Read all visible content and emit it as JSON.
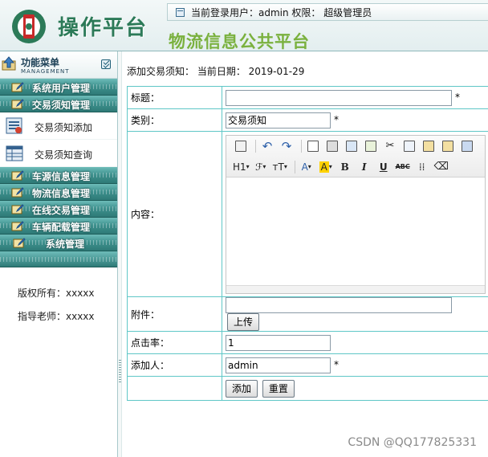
{
  "header": {
    "logo_text": "操作平台",
    "login_info": "当前登录用户：admin 权限： 超级管理员",
    "platform_title": "物流信息公共平台"
  },
  "sidebar": {
    "menu_title": "功能菜单",
    "menu_subtitle": "MANAGEMENT",
    "groups": [
      {
        "label": "系统用户管理"
      },
      {
        "label": "交易须知管理",
        "items": [
          {
            "label": "交易须知添加"
          },
          {
            "label": "交易须知查询"
          }
        ]
      },
      {
        "label": "车源信息管理"
      },
      {
        "label": "物流信息管理"
      },
      {
        "label": "在线交易管理"
      },
      {
        "label": "车辆配载管理"
      },
      {
        "label": "系统管理"
      }
    ],
    "copyright": "版权所有：xxxxx",
    "teacher": "指导老师：xxxxx"
  },
  "main": {
    "page_heading": "添加交易须知： 当前日期： 2019-01-29",
    "form": {
      "title_label": "标题：",
      "title_value": "",
      "required_mark": "*",
      "category_label": "类别：",
      "category_value": "交易须知",
      "content_label": "内容：",
      "attachment_label": "附件：",
      "attachment_value": "",
      "upload_button": "上传",
      "clicks_label": "点击率：",
      "clicks_value": "1",
      "adder_label": "添加人：",
      "adder_value": "admin",
      "submit_button": "添加",
      "reset_button": "重置"
    },
    "editor_toolbar": {
      "heading_label": "H1",
      "font_family_label": "ℱ",
      "font_size_label": "ᴛT",
      "font_color_label": "A",
      "bg_color_label": "A",
      "bold_label": "B",
      "italic_label": "I",
      "underline_label": "U",
      "strike_label": "ABC"
    }
  },
  "watermark": "CSDN @QQ177825331",
  "colors": {
    "accent_teal": "#3d8f8c",
    "table_border": "#5fc7c7",
    "title_green": "#7ab13e",
    "logo_green": "#2c7a58"
  }
}
